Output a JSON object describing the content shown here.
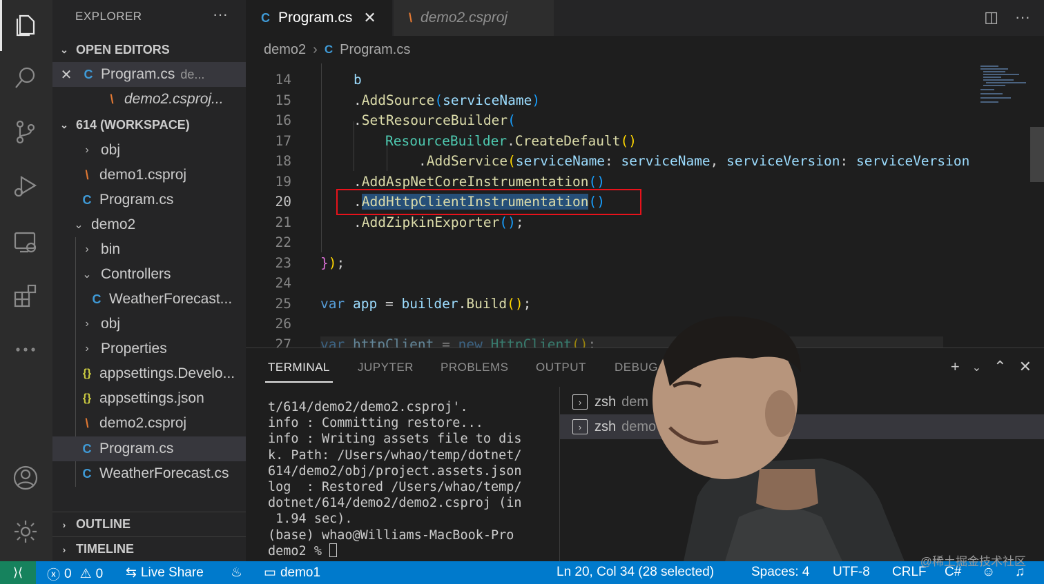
{
  "sidebar": {
    "title": "EXPLORER",
    "more": "···",
    "open_editors_label": "OPEN EDITORS",
    "open_editors": [
      {
        "name": "Program.cs",
        "desc": "de..."
      },
      {
        "name": "demo2.csproj..."
      }
    ],
    "workspace_label": "614 (WORKSPACE)",
    "tree": [
      "obj",
      "demo1.csproj",
      "Program.cs",
      "demo2",
      "bin",
      "Controllers",
      "WeatherForecast...",
      "obj",
      "Properties",
      "appsettings.Develo...",
      "appsettings.json",
      "demo2.csproj",
      "Program.cs",
      "WeatherForecast.cs"
    ],
    "outline_label": "OUTLINE",
    "timeline_label": "TIMELINE"
  },
  "tabs": [
    {
      "label": "Program.cs",
      "active": true
    },
    {
      "label": "demo2.csproj",
      "active": false
    }
  ],
  "breadcrumb": {
    "folder": "demo2",
    "file": "Program.cs"
  },
  "editor": {
    "line_numbers": [
      "14",
      "15",
      "16",
      "17",
      "18",
      "19",
      "20",
      "21",
      "22",
      "23",
      "24",
      "25",
      "26",
      "27"
    ],
    "current_line": "20"
  },
  "panel": {
    "tabs": [
      "TERMINAL",
      "JUPYTER",
      "PROBLEMS",
      "OUTPUT",
      "DEBUG"
    ],
    "active_tab": "TERMINAL",
    "terminal_lines": [
      "t/614/demo2/demo2.csproj'.",
      "info : Committing restore...",
      "info : Writing assets file to dis",
      "k. Path: /Users/whao/temp/dotnet/",
      "614/demo2/obj/project.assets.json",
      "log  : Restored /Users/whao/temp/",
      "dotnet/614/demo2/demo2.csproj (in",
      " 1.94 sec).",
      "(base) whao@Williams-MacBook-Pro",
      "demo2 % "
    ],
    "terminals": [
      {
        "shell": "zsh",
        "name": "dem"
      },
      {
        "shell": "zsh",
        "name": "demo"
      }
    ]
  },
  "status": {
    "errors": "0",
    "warnings": "0",
    "live_share": "Live Share",
    "folder": "demo1",
    "position": "Ln 20, Col 34 (28 selected)",
    "spaces": "Spaces: 4",
    "encoding": "UTF-8",
    "eol": "CRLF",
    "language": "C#"
  },
  "watermark": "@稀土掘金技术社区",
  "colors": {
    "accent": "#007acc",
    "remote": "#16825d",
    "highlight_box": "#e8121b"
  }
}
